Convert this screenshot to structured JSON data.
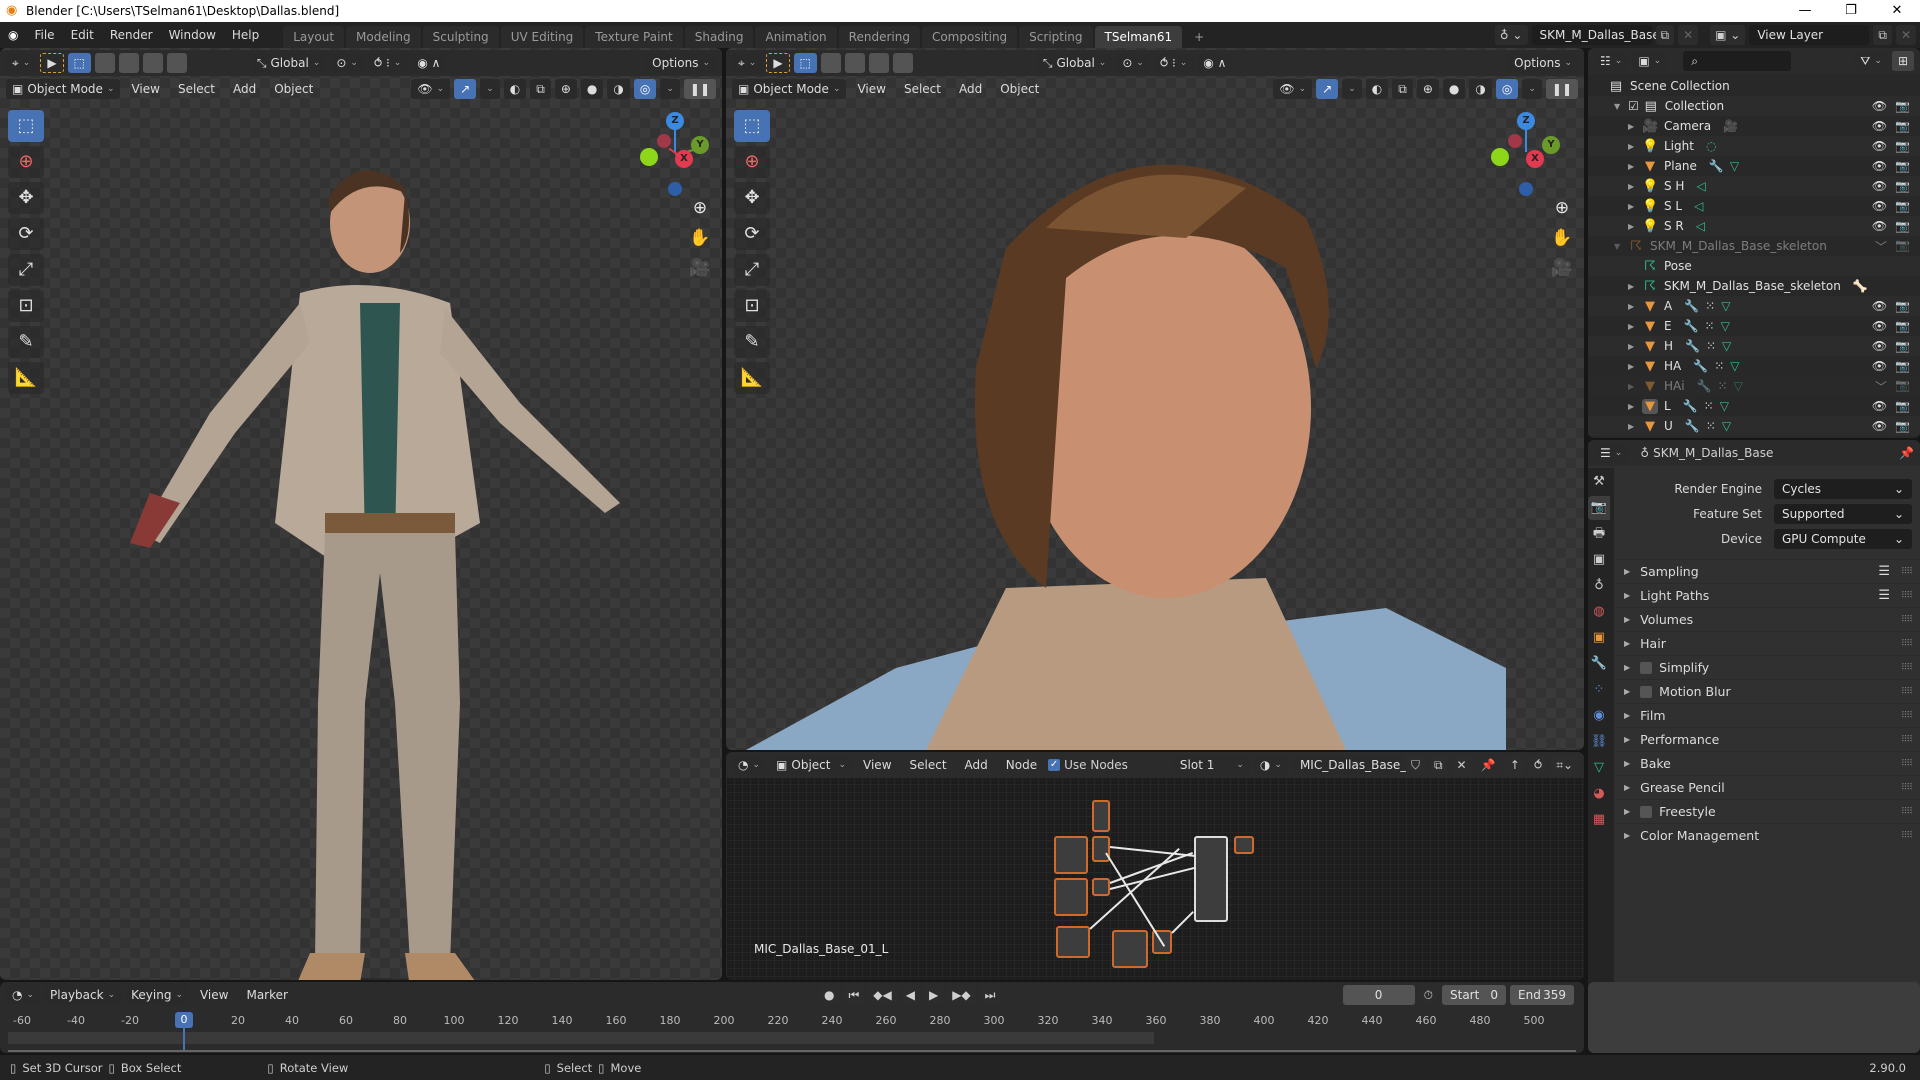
{
  "window": {
    "title": "Blender [C:\\Users\\TSelman61\\Desktop\\Dallas.blend]",
    "controls": [
      "—",
      "❐",
      "✕"
    ]
  },
  "topbar": {
    "menus": [
      "File",
      "Edit",
      "Render",
      "Window",
      "Help"
    ],
    "workspaces": [
      "Layout",
      "Modeling",
      "Sculpting",
      "UV Editing",
      "Texture Paint",
      "Shading",
      "Animation",
      "Rendering",
      "Compositing",
      "Scripting",
      "TSelman61"
    ],
    "active_workspace": "TSelman61",
    "add_workspace": "+",
    "scene": "SKM_M_Dallas_Base",
    "view_layer": "View Layer"
  },
  "viewport_left": {
    "orientation": "Global",
    "options_label": "Options",
    "mode": "Object Mode",
    "menus": [
      "View",
      "Select",
      "Add",
      "Object"
    ],
    "tools": [
      "select-box",
      "cursor",
      "move",
      "rotate",
      "scale",
      "transform",
      "annotate",
      "measure"
    ],
    "gizmo_axes": [
      "Z",
      "Y",
      "X"
    ]
  },
  "viewport_right": {
    "orientation": "Global",
    "options_label": "Options",
    "mode": "Object Mode",
    "menus": [
      "View",
      "Select",
      "Add",
      "Object"
    ]
  },
  "node_editor": {
    "type": "Object",
    "menus": [
      "View",
      "Select",
      "Add",
      "Node"
    ],
    "use_nodes_label": "Use Nodes",
    "use_nodes": true,
    "slot": "Slot 1",
    "material": "MIC_Dallas_Base_0...",
    "material_label": "MIC_Dallas_Base_01_L"
  },
  "outliner": {
    "search_placeholder": "",
    "root": "Scene Collection",
    "items": [
      {
        "name": "Collection",
        "type": "collection",
        "level": 1,
        "checked": true,
        "visible": true
      },
      {
        "name": "Camera",
        "type": "camera",
        "level": 2,
        "extras": [
          "camera-data"
        ],
        "visible": true
      },
      {
        "name": "Light",
        "type": "light",
        "level": 2,
        "extras": [
          "light-data"
        ],
        "visible": true
      },
      {
        "name": "Plane",
        "type": "mesh",
        "level": 2,
        "extras": [
          "modifier",
          "mesh-data"
        ],
        "visible": true
      },
      {
        "name": "S H",
        "type": "light",
        "level": 2,
        "extras": [
          "spot-data"
        ],
        "visible": true
      },
      {
        "name": "S L",
        "type": "light",
        "level": 2,
        "extras": [
          "spot-data"
        ],
        "visible": true
      },
      {
        "name": "S R",
        "type": "light",
        "level": 2,
        "extras": [
          "spot-data"
        ],
        "visible": true
      },
      {
        "name": "SKM_M_Dallas_Base_skeleton",
        "type": "armature",
        "level": 1,
        "dim": true,
        "visible": false
      },
      {
        "name": "Pose",
        "type": "pose",
        "level": 2
      },
      {
        "name": "SKM_M_Dallas_Base_skeleton",
        "type": "armature-data",
        "level": 2,
        "extras": [
          "bone"
        ]
      },
      {
        "name": "A",
        "type": "mesh",
        "level": 2,
        "extras": [
          "modifier",
          "vertex-groups",
          "mesh-data"
        ],
        "visible": true
      },
      {
        "name": "E",
        "type": "mesh",
        "level": 2,
        "extras": [
          "modifier",
          "vertex-groups",
          "mesh-data"
        ],
        "visible": true
      },
      {
        "name": "H",
        "type": "mesh",
        "level": 2,
        "extras": [
          "modifier",
          "vertex-groups",
          "mesh-data"
        ],
        "visible": true
      },
      {
        "name": "HA",
        "type": "mesh",
        "level": 2,
        "extras": [
          "modifier",
          "vertex-groups",
          "mesh-data"
        ],
        "visible": true
      },
      {
        "name": "HAi",
        "type": "mesh",
        "level": 2,
        "dim": true,
        "extras": [
          "modifier",
          "vertex-groups",
          "mesh-data"
        ],
        "visible": false
      },
      {
        "name": "L",
        "type": "mesh",
        "level": 2,
        "active": true,
        "extras": [
          "modifier",
          "vertex-groups",
          "mesh-data"
        ],
        "visible": true
      },
      {
        "name": "U",
        "type": "mesh",
        "level": 2,
        "extras": [
          "modifier",
          "vertex-groups",
          "mesh-data"
        ],
        "visible": true
      }
    ]
  },
  "properties": {
    "context": "SKM_M_Dallas_Base",
    "fields": [
      {
        "label": "Render Engine",
        "value": "Cycles"
      },
      {
        "label": "Feature Set",
        "value": "Supported"
      },
      {
        "label": "Device",
        "value": "GPU Compute"
      }
    ],
    "panels": [
      {
        "label": "Sampling",
        "list_icon": true
      },
      {
        "label": "Light Paths",
        "list_icon": true
      },
      {
        "label": "Volumes"
      },
      {
        "label": "Hair"
      },
      {
        "label": "Simplify",
        "checkbox": true
      },
      {
        "label": "Motion Blur",
        "checkbox": true
      },
      {
        "label": "Film"
      },
      {
        "label": "Performance"
      },
      {
        "label": "Bake"
      },
      {
        "label": "Grease Pencil"
      },
      {
        "label": "Freestyle",
        "checkbox": true
      },
      {
        "label": "Color Management"
      }
    ],
    "tabs": [
      "tool",
      "render",
      "output",
      "view-layer",
      "scene",
      "world",
      "object",
      "modifiers",
      "particles",
      "physics",
      "constraints",
      "data",
      "material",
      "texture"
    ],
    "active_tab": "render"
  },
  "timeline": {
    "menus": [
      "Playback",
      "Keying",
      "View",
      "Marker"
    ],
    "current_frame": "0",
    "start_label": "Start",
    "start": "0",
    "end_label": "End",
    "end": "359",
    "ticks": [
      "-60",
      "-40",
      "-20",
      "0",
      "20",
      "40",
      "60",
      "80",
      "100",
      "120",
      "140",
      "160",
      "180",
      "200",
      "220",
      "240",
      "260",
      "280",
      "300",
      "320",
      "340",
      "360",
      "380",
      "400",
      "420",
      "440",
      "460",
      "480",
      "500"
    ]
  },
  "statusbar": {
    "hints": [
      "Set 3D Cursor",
      "Box Select",
      "Rotate View",
      "Select",
      "Move"
    ],
    "version": "2.90.0"
  }
}
